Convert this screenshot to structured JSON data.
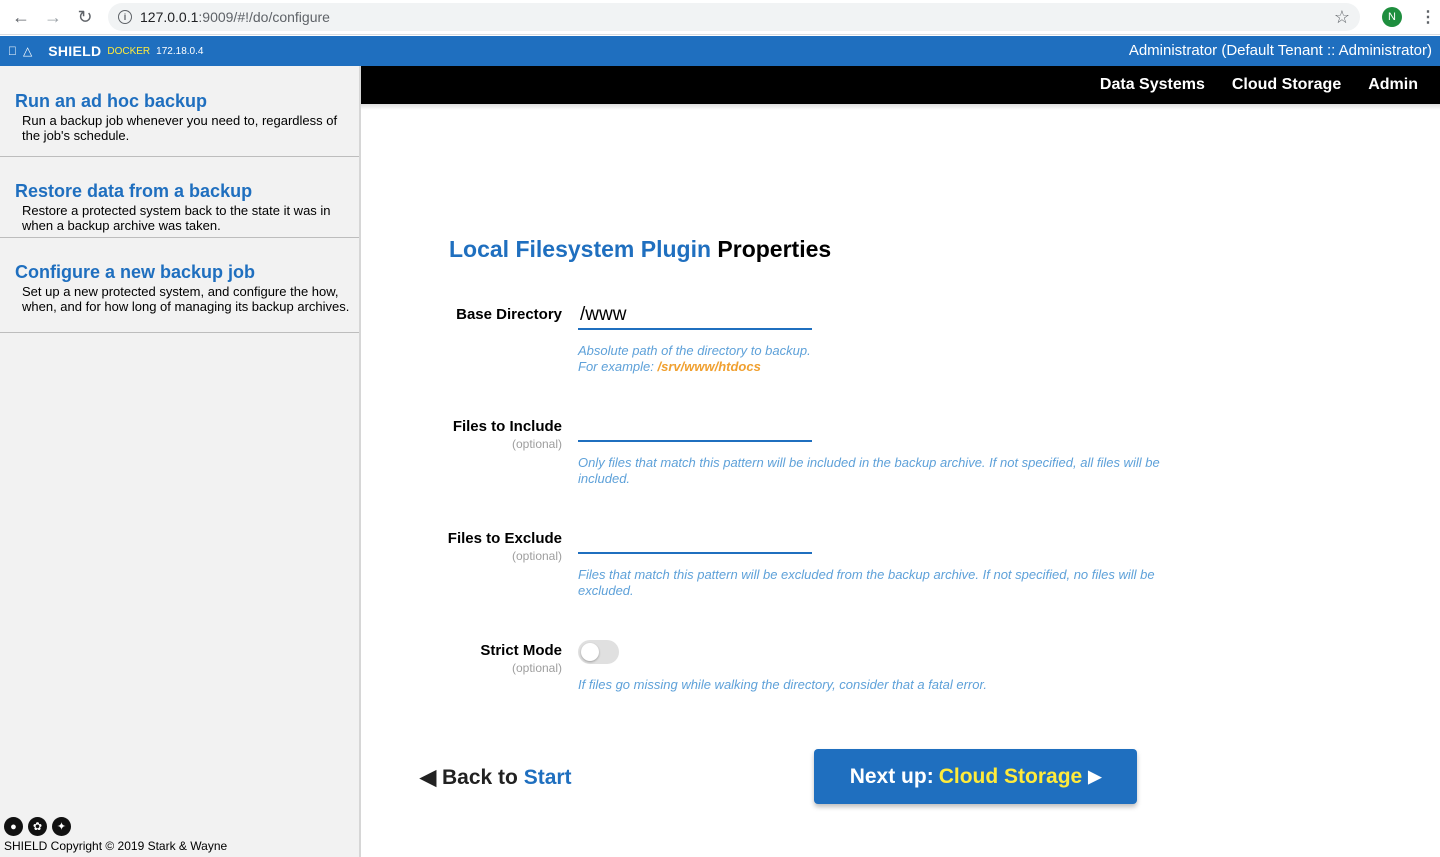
{
  "browser": {
    "url_host": "127.0.0.1",
    "url_path": ":9009/#!/do/configure",
    "profile_initial": "N"
  },
  "topbar": {
    "brand": "SHIELD",
    "env": "DOCKER",
    "ip": "172.18.0.4",
    "user": "Administrator (Default Tenant :: Administrator)"
  },
  "sidebar": {
    "items": [
      {
        "title": "Run an ad hoc backup",
        "desc": "Run a backup job whenever you need to, regardless of the job's schedule."
      },
      {
        "title": "Restore data from a backup",
        "desc": "Restore a protected system back to the state it was in when a backup archive was taken."
      },
      {
        "title": "Configure a new backup job",
        "desc": "Set up a new protected system, and configure the how, when, and for how long of managing its backup archives."
      }
    ],
    "copyright": "SHIELD Copyright © 2019 Stark & Wayne"
  },
  "nav": {
    "data_systems": "Data Systems",
    "cloud_storage": "Cloud Storage",
    "admin": "Admin"
  },
  "form": {
    "plugin_name": "Local Filesystem Plugin",
    "title_suffix": "Properties",
    "optional_text": "(optional)",
    "base_dir": {
      "label": "Base Directory",
      "value": "/www",
      "help": "Absolute path of the directory to backup.",
      "example_prefix": "For example:",
      "example": "/srv/www/htdocs"
    },
    "include": {
      "label": "Files to Include",
      "value": "",
      "help": "Only files that match this pattern will be included in the backup archive. If not specified, all files will be included."
    },
    "exclude": {
      "label": "Files to Exclude",
      "value": "",
      "help": "Files that match this pattern will be excluded from the backup archive. If not specified, no files will be excluded."
    },
    "strict": {
      "label": "Strict Mode",
      "enabled": false,
      "help": "If files go missing while walking the directory, consider that a fatal error."
    }
  },
  "footer_nav": {
    "back_prefix": "Back to",
    "back_target": "Start",
    "next_prefix": "Next up:",
    "next_target": "Cloud Storage"
  }
}
